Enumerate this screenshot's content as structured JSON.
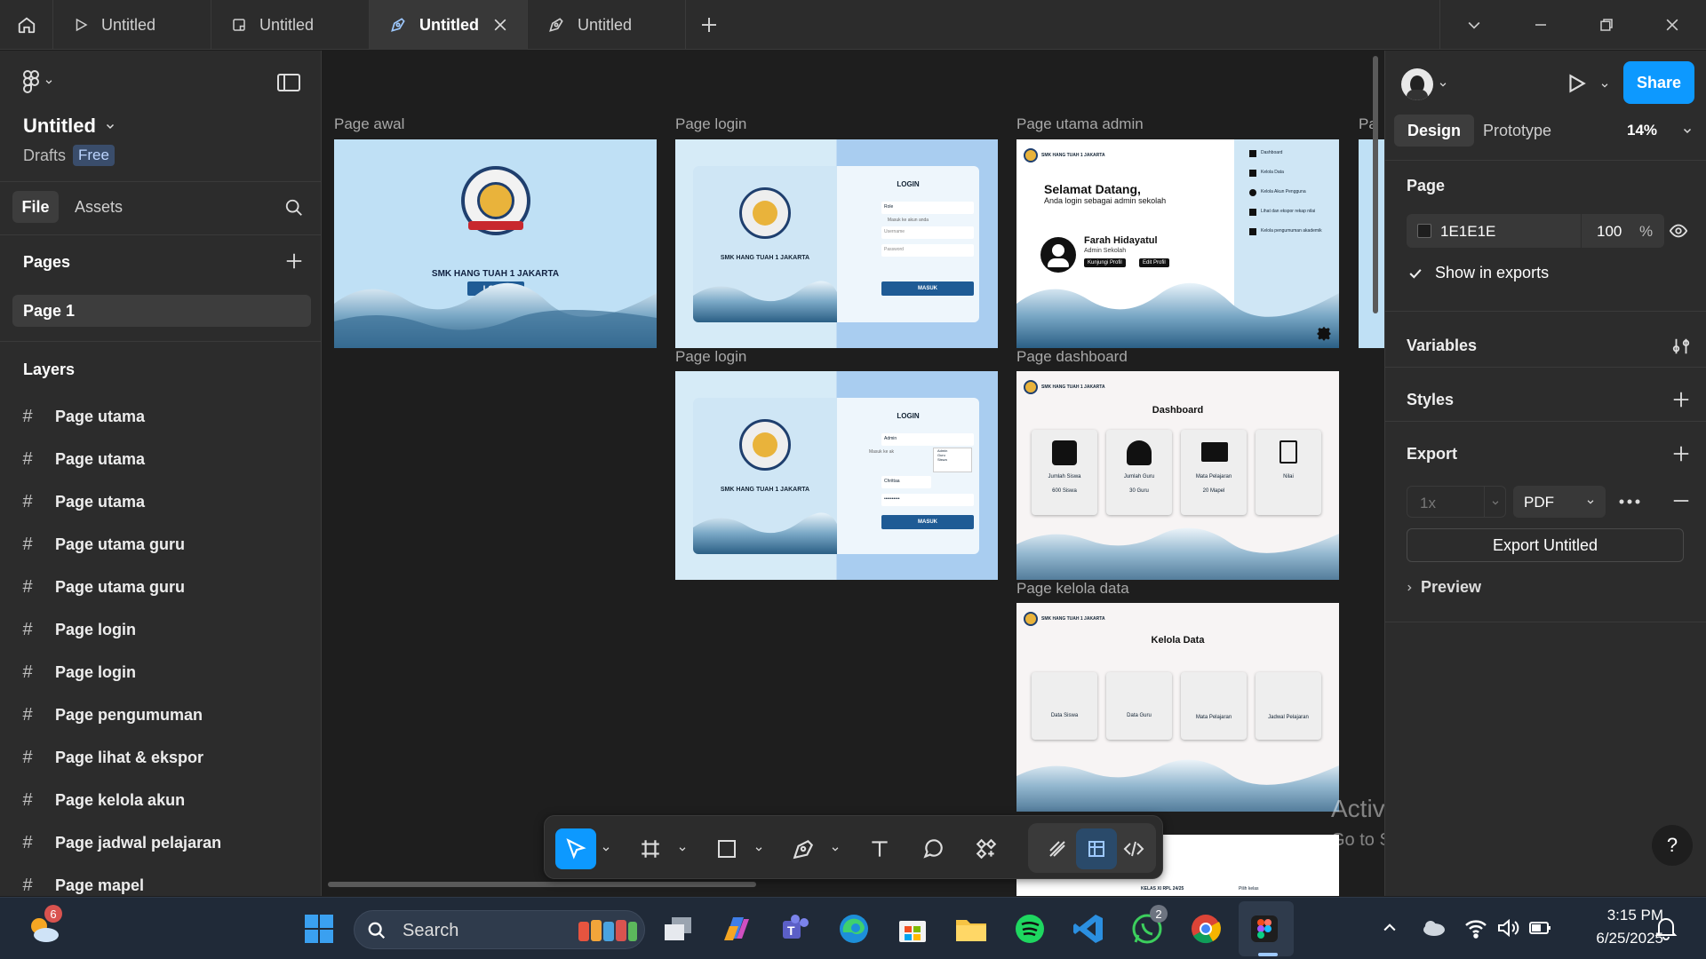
{
  "tabs": [
    {
      "label": "Untitled",
      "icon": "play-icon",
      "active": false
    },
    {
      "label": "Untitled",
      "icon": "file-icon",
      "active": false
    },
    {
      "label": "Untitled",
      "icon": "figma-file-icon",
      "active": true
    },
    {
      "label": "Untitled",
      "icon": "figma-file-icon",
      "active": false
    }
  ],
  "file": {
    "name": "Untitled",
    "location": "Drafts",
    "plan": "Free"
  },
  "left_tabs": {
    "file": "File",
    "assets": "Assets"
  },
  "pages": {
    "title": "Pages",
    "items": [
      "Page 1"
    ]
  },
  "layers": {
    "title": "Layers",
    "items": [
      "Page utama",
      "Page utama",
      "Page utama",
      "Page utama guru",
      "Page utama guru",
      "Page login",
      "Page login",
      "Page pengumuman",
      "Page lihat & ekspor",
      "Page kelola akun",
      "Page jadwal pelajaran",
      "Page mapel"
    ]
  },
  "canvas": {
    "frames": {
      "awal": "Page awal",
      "login1": "Page login",
      "utama_admin": "Page utama admin",
      "cut": "Pa",
      "login2": "Page login",
      "dashboard": "Page dashboard",
      "kelola": "Page kelola data"
    },
    "awal": {
      "school": "SMK HANG TUAH 1 JAKARTA",
      "button": "LOGIN"
    },
    "login1": {
      "school": "SMK HANG TUAH 1 JAKARTA",
      "title": "LOGIN",
      "role": "Role",
      "hint": "Masuk ke akun anda",
      "username": "Username",
      "password": "Password",
      "button": "MASUK"
    },
    "login2": {
      "school": "SMK HANG TUAH 1 JAKARTA",
      "title": "LOGIN",
      "role": "Admin",
      "opt1": "Admin",
      "opt2": "Guru",
      "opt3": "Siswa",
      "hint": "Masuk ke ak",
      "username": "Chrittaa",
      "password": "••••••••••",
      "button": "MASUK"
    },
    "utama_admin": {
      "school": "SMK HANG TUAH 1 JAKARTA",
      "welcome": "Selamat Datang,",
      "sub": "Anda login sebagai admin sekolah",
      "name": "Farah Hidayatul",
      "role": "Admin Sekolah",
      "btn1": "Kunjungi Profil",
      "btn2": "Edit Profil",
      "menu": [
        "Dashboard",
        "Kelola Data",
        "Kelola Akun Pengguna",
        "Lihat dan ekspor rekap nilai",
        "Kelola pengumuman akademik"
      ]
    },
    "dashboard": {
      "school": "SMK HANG TUAH 1 JAKARTA",
      "title": "Dashboard",
      "cards": [
        {
          "label": "Jumlah Siswa",
          "value": "600 Siswa"
        },
        {
          "label": "Jumlah Guru",
          "value": "30 Guru"
        },
        {
          "label": "Mata Pelajaran",
          "value": "20 Mapel"
        },
        {
          "label": "Nilai",
          "value": ""
        }
      ]
    },
    "kelola": {
      "school": "SMK HANG TUAH 1 JAKARTA",
      "title": "Kelola Data",
      "cards": [
        "Data Siswa",
        "Data Guru",
        "Mata Pelajaran",
        "Jadwal Pelajaran"
      ]
    },
    "partial": {
      "class": "KELAS XI RPL 24/25",
      "select": "Pilih kelas"
    }
  },
  "right": {
    "tabs": {
      "design": "Design",
      "prototype": "Prototype"
    },
    "zoom": "14%",
    "share": "Share",
    "page": {
      "title": "Page",
      "color": "1E1E1E",
      "opacity": "100",
      "unit": "%",
      "show_exports": "Show in exports"
    },
    "variables": "Variables",
    "styles": "Styles",
    "export": {
      "title": "Export",
      "scale": "1x",
      "format": "PDF",
      "button": "Export Untitled",
      "preview": "Preview"
    }
  },
  "watermark": {
    "line1": "Activate Windows",
    "line2": "Go to Settings to activate Windows."
  },
  "help": "?",
  "taskbar": {
    "search": "Search",
    "time": "3:15 PM",
    "date": "6/25/2025",
    "weather_badge": "6",
    "whatsapp_badge": "2"
  },
  "colors": {
    "accent": "#0d99ff",
    "panel": "#2c2c2c",
    "canvas": "#1e1e1e",
    "frame_bg": "#bfe0f5"
  }
}
